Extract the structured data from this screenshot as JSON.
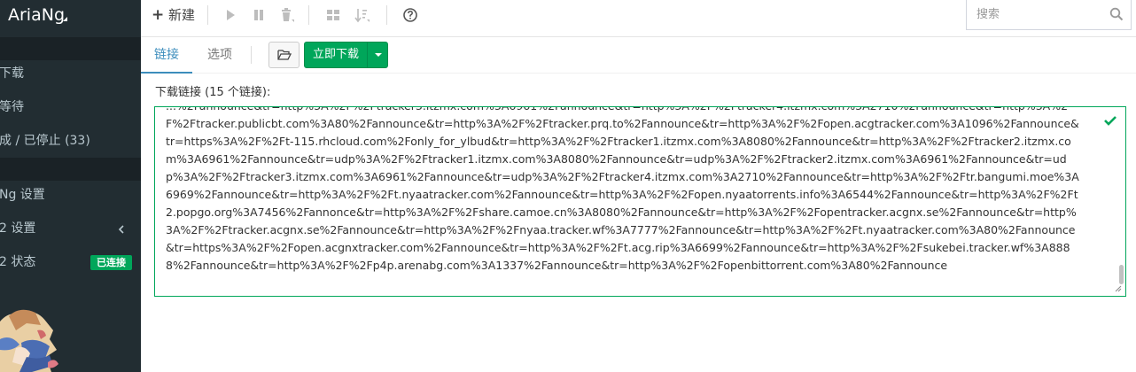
{
  "app": {
    "brand": "AriaNg"
  },
  "sidebar": {
    "items": [
      {
        "label": "下载"
      },
      {
        "label": "等待"
      },
      {
        "label": "成 / 已停止 (33)"
      },
      {
        "label": "Ng 设置"
      },
      {
        "label": "2 设置"
      },
      {
        "label": "2 状态",
        "badge": "已连接"
      }
    ]
  },
  "toolbar": {
    "new_label": "新建",
    "search_placeholder": "搜索"
  },
  "tabs": [
    {
      "label": "链接",
      "active": true
    },
    {
      "label": "选项",
      "active": false
    }
  ],
  "actions": {
    "download_now": "立即下载"
  },
  "form": {
    "links_label": "下载链接 (15 个链接):",
    "links_text": "...%2Fannounce&tr=http%3A%2F%2Ftracker3.itzmx.com%3A6961%2Fannounce&tr=http%3A%2F%2Ftracker4.itzmx.com%3A2710%2Fannounce&tr=http%3A%2F%2Ftracker.publicbt.com%3A80%2Fannounce&tr=http%3A%2F%2Ftracker.prq.to%2Fannounce&tr=http%3A%2F%2Fopen.acgtracker.com%3A1096%2Fannounce&tr=https%3A%2F%2Ft-115.rhcloud.com%2Fonly_for_ylbud&tr=http%3A%2F%2Ftracker1.itzmx.com%3A8080%2Fannounce&tr=http%3A%2F%2Ftracker2.itzmx.com%3A6961%2Fannounce&tr=udp%3A%2F%2Ftracker1.itzmx.com%3A8080%2Fannounce&tr=udp%3A%2F%2Ftracker2.itzmx.com%3A6961%2Fannounce&tr=udp%3A%2F%2Ftracker3.itzmx.com%3A6961%2Fannounce&tr=udp%3A%2F%2Ftracker4.itzmx.com%3A2710%2Fannounce&tr=http%3A%2F%2Ftr.bangumi.moe%3A6969%2Fannounce&tr=http%3A%2F%2Ft.nyaatracker.com%2Fannounce&tr=http%3A%2F%2Fopen.nyaatorrents.info%3A6544%2Fannounce&tr=http%3A%2F%2Ft2.popgo.org%3A7456%2Fannonce&tr=http%3A%2F%2Fshare.camoe.cn%3A8080%2Fannounce&tr=http%3A%2F%2Fopentracker.acgnx.se%2Fannounce&tr=http%3A%2F%2Ftracker.acgnx.se%2Fannounce&tr=http%3A%2F%2Fnyaa.tracker.wf%3A7777%2Fannounce&tr=http%3A%2F%2Ft.nyaatracker.com%3A80%2Fannounce&tr=https%3A%2F%2Fopen.acgnxtracker.com%2Fannounce&tr=http%3A%2F%2Ft.acg.rip%3A6699%2Fannounce&tr=http%3A%2F%2Fsukebei.tracker.wf%3A8888%2Fannounce&tr=http%3A%2F%2Fp4p.arenabg.com%3A1337%2Fannounce&tr=http%3A%2F%2Fopenbittorrent.com%3A80%2Fannounce"
  },
  "colors": {
    "sidebar_bg": "#222d32",
    "accent": "#3c8dbc",
    "success": "#00a65a"
  }
}
